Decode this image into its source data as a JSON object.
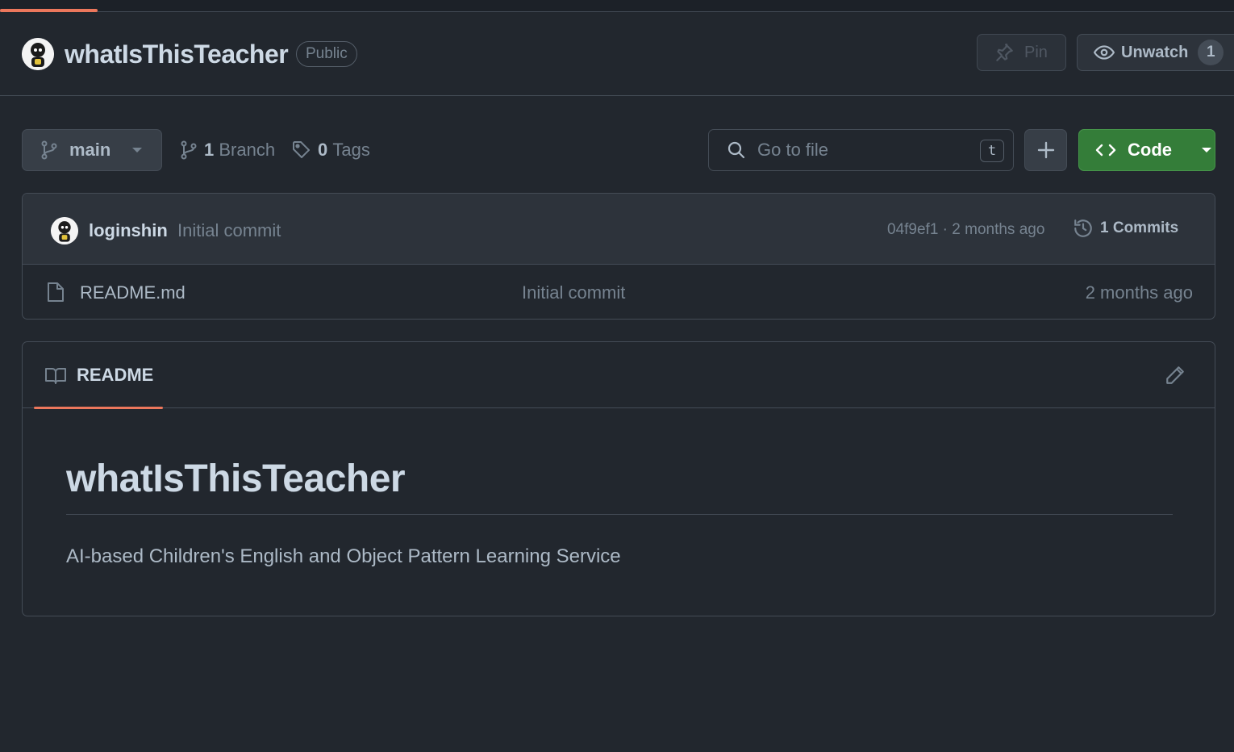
{
  "repo": {
    "name": "whatIsThisTeacher",
    "visibility": "Public",
    "pin_label": "Pin",
    "unwatch_label": "Unwatch",
    "watch_count": "1"
  },
  "toolbar": {
    "branch": "main",
    "branch_count": "1",
    "branch_label": "Branch",
    "tag_count": "0",
    "tag_label": "Tags",
    "search_placeholder": "Go to file",
    "search_shortcut": "t",
    "code_label": "Code"
  },
  "latest_commit": {
    "author": "loginshin",
    "message": "Initial commit",
    "meta": "04f9ef1 · 2 months ago",
    "commit_count": "1 Commits"
  },
  "files": [
    {
      "name": "README.md",
      "commit": "Initial commit",
      "age": "2 months ago"
    }
  ],
  "readme": {
    "tab_label": "README",
    "title": "whatIsThisTeacher",
    "description": "AI-based Children's English and Object Pattern Learning Service"
  },
  "colors": {
    "background": "#22272e",
    "accent": "#ec775c",
    "code_button": "#347d39"
  },
  "icons": [
    "pin-icon",
    "eye-icon",
    "git-branch-icon",
    "tag-icon",
    "search-icon",
    "plus-icon",
    "code-icon",
    "history-icon",
    "file-icon",
    "book-icon",
    "pencil-icon",
    "chevron-down-icon"
  ]
}
